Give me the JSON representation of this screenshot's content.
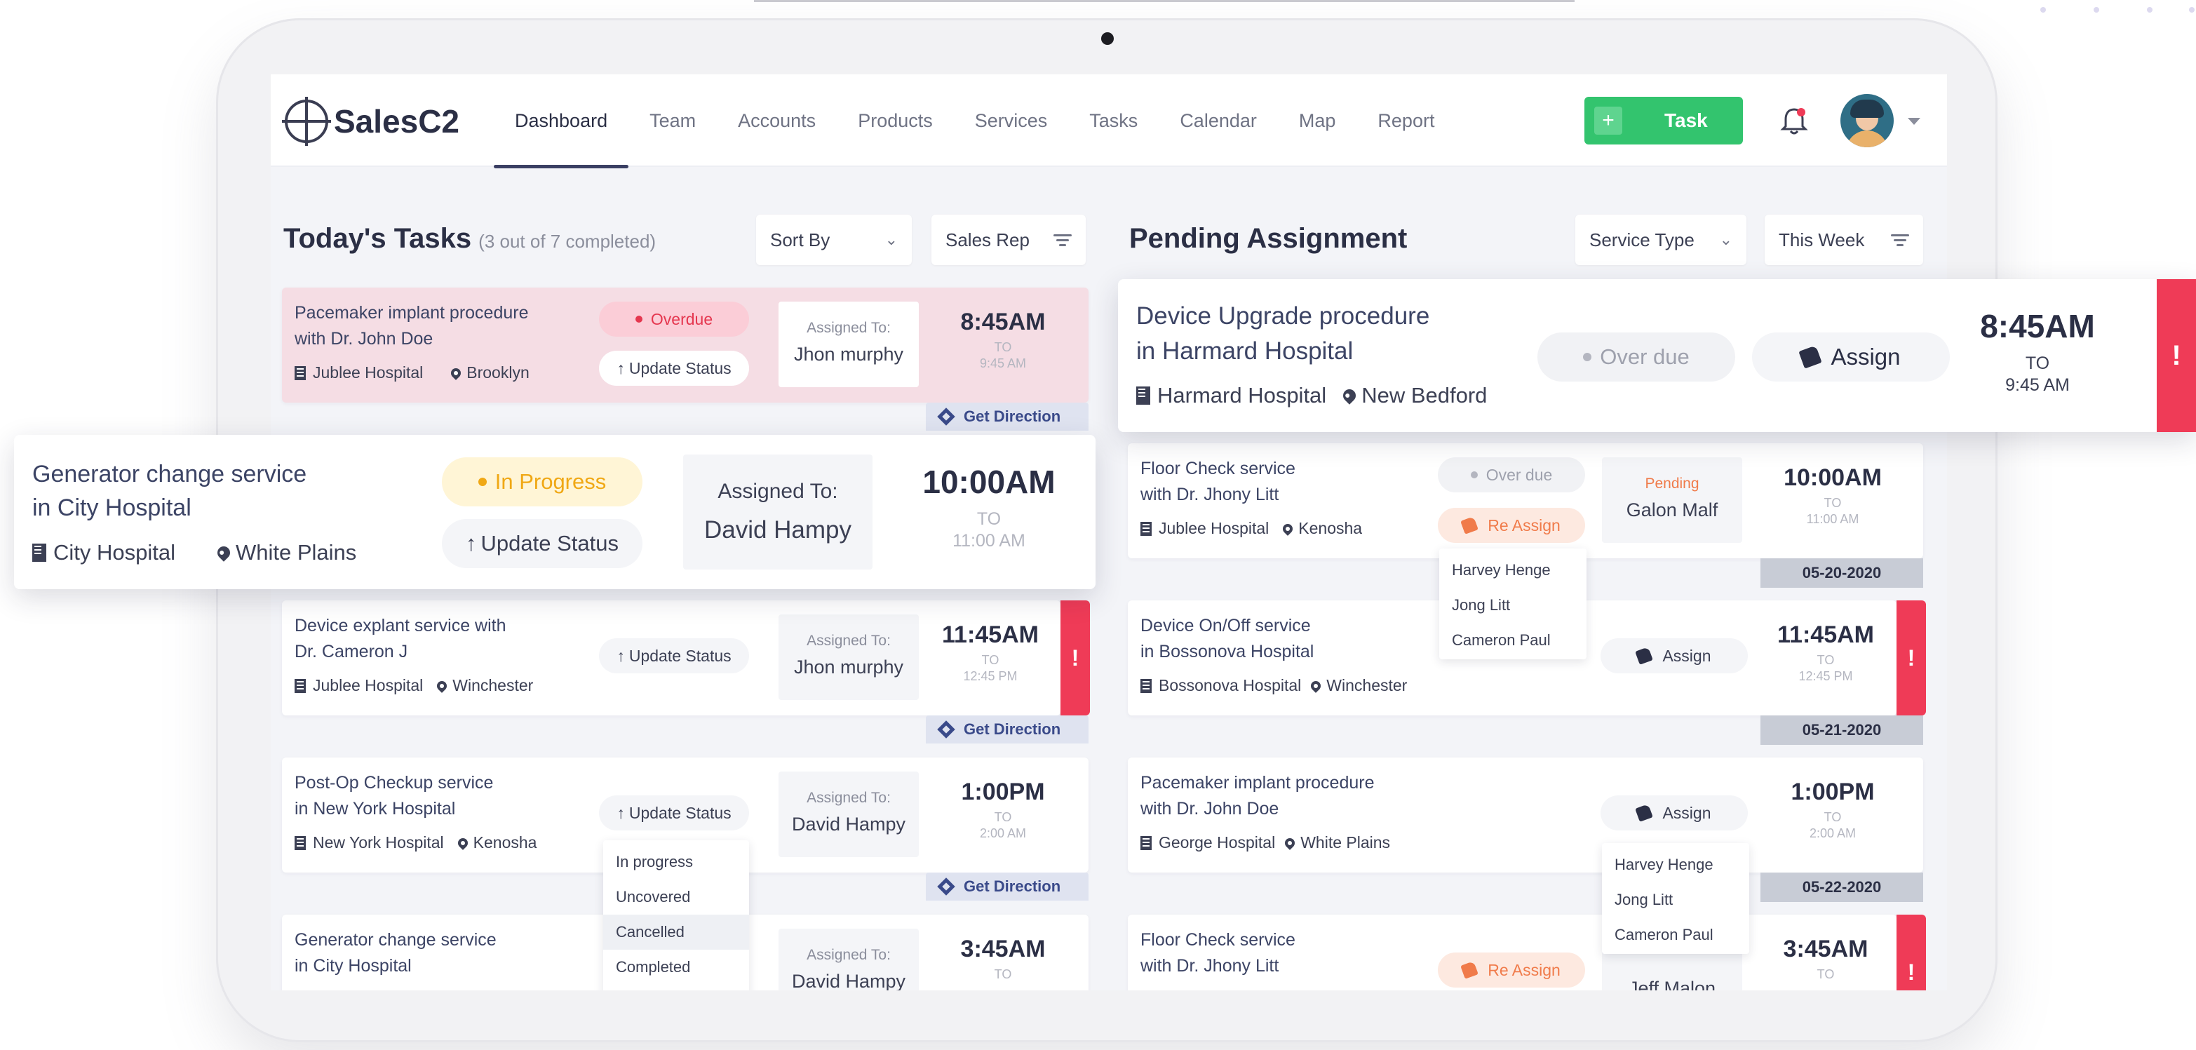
{
  "app": {
    "name": "SalesC2"
  },
  "nav": {
    "tabs": [
      "Dashboard",
      "Team",
      "Accounts",
      "Products",
      "Services",
      "Tasks",
      "Calendar",
      "Map",
      "Report"
    ],
    "task_button": {
      "plus": "+",
      "label": "Task"
    }
  },
  "colors": {
    "accent_green": "#33c46e",
    "overdue_red": "#ef3b57",
    "nav_active": "#3a3f63"
  },
  "today": {
    "title": "Today's Tasks",
    "subtitle": "(3 out of 7 completed)",
    "sort_by": "Sort By",
    "sales_rep": "Sales Rep",
    "assigned_label": "Assigned To:",
    "to_label": "TO",
    "direction_label": "Get Direction",
    "update_status": "Update Status",
    "cards": [
      {
        "title1": "Pacemaker implant procedure",
        "title2": "with Dr. John Doe",
        "hospital": "Jublee Hospital",
        "city": "Brooklyn",
        "badge": "Overdue",
        "assignee": "Jhon murphy",
        "start": "8:45AM",
        "end": "9:45 AM"
      },
      {
        "title1": "Device explant service with",
        "title2": "Dr. Cameron J",
        "hospital": "Jublee Hospital",
        "city": "Winchester",
        "assignee": "Jhon murphy",
        "start": "11:45AM",
        "end": "12:45 PM",
        "flag": "!"
      },
      {
        "title1": "Post-Op Checkup service",
        "title2": "in New York Hospital",
        "hospital": "New York Hospital",
        "city": "Kenosha",
        "assignee": "David Hampy",
        "start": "1:00PM",
        "end": "2:00 AM"
      },
      {
        "title1": "Generator change service",
        "title2": "in City Hospital",
        "assignee": "David Hampy",
        "start": "3:45AM"
      }
    ],
    "status_options": [
      "In progress",
      "Uncovered",
      "Cancelled",
      "Completed"
    ]
  },
  "float_left": {
    "title1": "Generator change service",
    "title2": "in City Hospital",
    "hospital": "City Hospital",
    "city": "White Plains",
    "badge": "In Progress",
    "update_status": "Update Status",
    "assigned_label": "Assigned To:",
    "assignee": "David Hampy",
    "start": "10:00AM",
    "to_label": "TO",
    "end": "11:00 AM"
  },
  "pending": {
    "title": "Pending Assignment",
    "service_type": "Service Type",
    "this_week": "This Week",
    "to_label": "TO",
    "assign_label": "Assign",
    "reassign_label": "Re Assign",
    "overdue_label": "Over due",
    "cards": [
      {
        "title1": "Floor Check service",
        "title2": "with Dr. Jhony Litt",
        "hospital": "Jublee Hospital",
        "city": "Kenosha",
        "status": "Pending",
        "assignee": "Galon Malf",
        "start": "10:00AM",
        "end": "11:00 AM",
        "date": "05-20-2020"
      },
      {
        "title1": "Device On/Off service",
        "title2": "in Bossonova Hospital",
        "hospital": "Bossonova Hospital",
        "city": "Winchester",
        "start": "11:45AM",
        "end": "12:45 PM",
        "date": "05-21-2020",
        "flag": "!"
      },
      {
        "title1": "Pacemaker implant procedure",
        "title2": "with Dr. John Doe",
        "hospital": "George Hospital",
        "city": "White Plains",
        "start": "1:00PM",
        "end": "2:00 AM",
        "date": "05-22-2020"
      },
      {
        "title1": "Floor Check service",
        "title2": "with Dr. Jhony Litt",
        "assignee": "Jeff Malon",
        "start": "3:45AM",
        "to": "TO",
        "flag": "!"
      }
    ],
    "reps_a": [
      "Harvey Henge",
      "Jong Litt",
      "Cameron Paul"
    ],
    "reps_b": [
      "Harvey Henge",
      "Jong Litt",
      "Cameron Paul"
    ]
  },
  "float_right": {
    "title1": "Device Upgrade procedure",
    "title2": "in Harmard Hospital",
    "hospital": "Harmard Hospital",
    "city": "New Bedford",
    "overdue": "Over due",
    "assign": "Assign",
    "start": "8:45AM",
    "to_label": "TO",
    "end": "9:45 AM",
    "flag": "!"
  }
}
